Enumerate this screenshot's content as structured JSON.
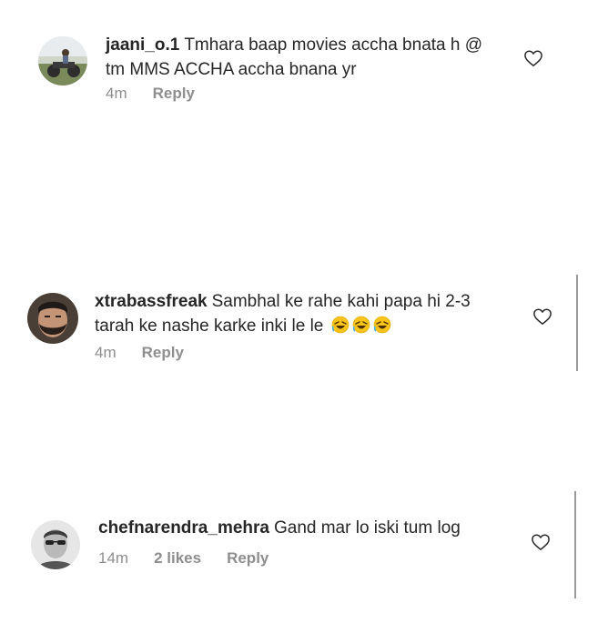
{
  "comments": [
    {
      "username": "jaani_o.1",
      "text_line1": "Tmhara baap movies accha bnata h @",
      "text_line2": "tm MMS ACCHA accha bnana yr",
      "time": "4m",
      "likes": "",
      "reply_label": "Reply",
      "avatar_icon": "avatar-photo-motorbike"
    },
    {
      "username": "xtrabassfreak",
      "text_line1": "Sambhal ke rahe kahi papa hi 2-3",
      "text_line2": "tarah ke nashe karke inki le le",
      "emoji_icon": "rofl-emoji",
      "time": "4m",
      "likes": "",
      "reply_label": "Reply",
      "avatar_icon": "avatar-photo-bearded-man"
    },
    {
      "username": "chefnarendra_mehra",
      "text_line1": "Gand mar lo iski tum log",
      "time": "14m",
      "likes": "2 likes",
      "reply_label": "Reply",
      "avatar_icon": "avatar-photo-man-sunglasses"
    }
  ],
  "icons": {
    "like": "heart-outline-icon"
  },
  "colors": {
    "text": "#262626",
    "meta": "#8e8e8e",
    "background": "#ffffff"
  }
}
